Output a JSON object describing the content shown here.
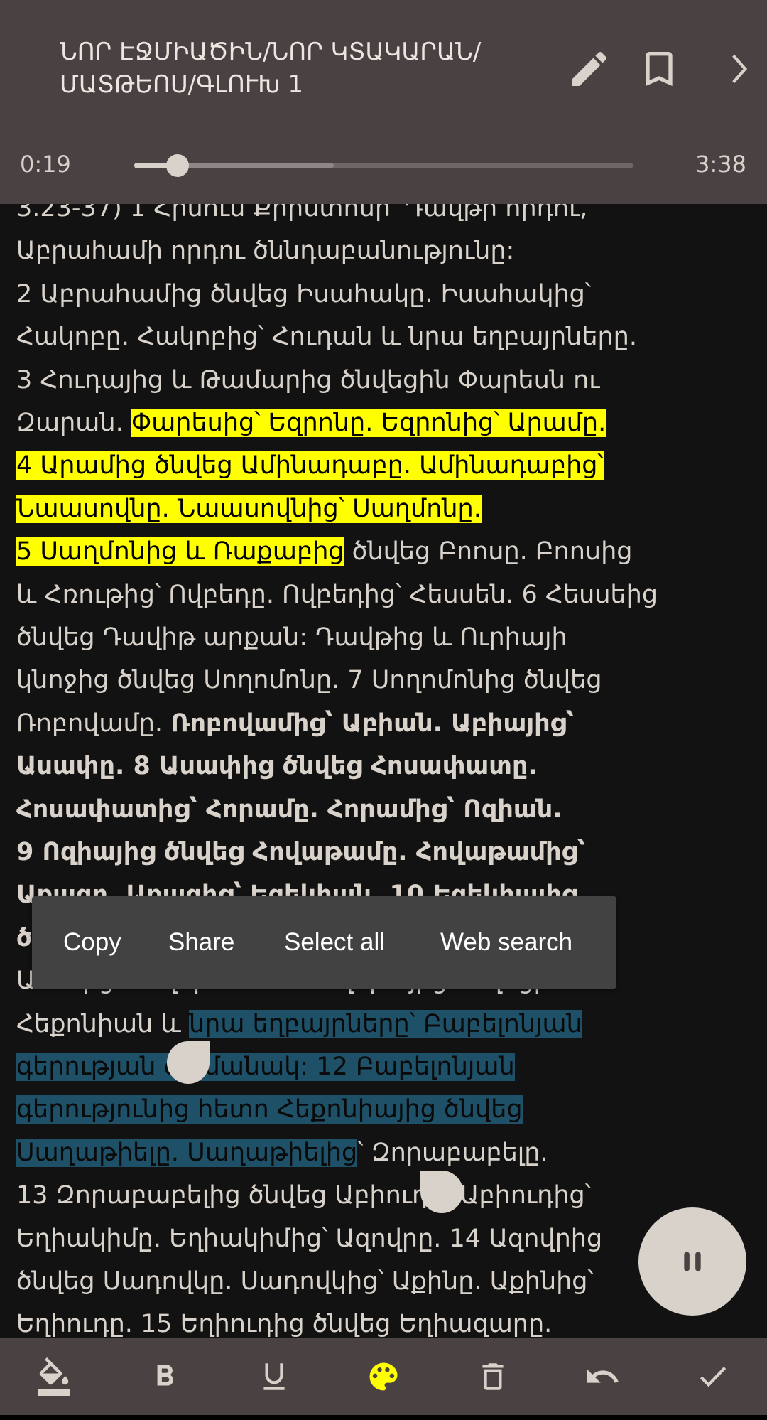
{
  "header": {
    "title_line1": "ՆՈՐ ԷՋՄԻԱԾԻՆ/ՆՈՐ ԿՏԱԿԱՐԱՆ/",
    "title_line2": "ՄԱՏԹԵՈՍ/ԳԼՈՒԽ 1",
    "icons": [
      "pencil-icon",
      "bookmark-icon",
      "chevron-right-icon"
    ]
  },
  "player": {
    "elapsed": "0:19",
    "duration": "3:38",
    "progress_percent": 8.7,
    "buffered_percent": 40
  },
  "text_lines": [
    [
      {
        "t": "3.23-37) 1 Հիսուս Քրիստոսի՝ Դավթի որդու,",
        "s": ""
      }
    ],
    [
      {
        "t": "Աբրահամի որդու ծննդաբանությունը:",
        "s": ""
      }
    ],
    [
      {
        "t": "2 Աբրահամից ծնվեց Իսահակը. Իսահակից՝",
        "s": ""
      }
    ],
    [
      {
        "t": "Հակոբը. Հակոբից՝ Հուդան և նրա եղբայրները.",
        "s": ""
      }
    ],
    [
      {
        "t": "3 Հուդայից և Թամարից ծնվեցին Փարեսն ու",
        "s": ""
      }
    ],
    [
      {
        "t": "Զարան. ",
        "s": ""
      },
      {
        "t": "Փարեսից՝ Եզրոնը. Եզրոնից՝ Արամը.",
        "s": "hl"
      }
    ],
    [
      {
        "t": "4 Արամից ծնվեց Ամինադաբը. Ամինադաբից՝",
        "s": "hl"
      }
    ],
    [
      {
        "t": "Նաասովնը. Նաասովնից՝ Սաղմոնը.",
        "s": "hl"
      }
    ],
    [
      {
        "t": "5 Սաղմոնից և Ռաքաբից",
        "s": "hl"
      },
      {
        "t": " ծնվեց Բոոսը. Բոոսից",
        "s": ""
      }
    ],
    [
      {
        "t": "և Հռութից՝ Ովբեդը. Ովբեդից՝ Հեսսեն. 6 Հեսսեից",
        "s": ""
      }
    ],
    [
      {
        "t": "ծնվեց Դավիթ արքան: Դավթից և Ուրիայի",
        "s": ""
      }
    ],
    [
      {
        "t": "կնոջից ծնվեց Սողոմոնը. 7 Սողոմոնից ծնվեց",
        "s": ""
      }
    ],
    [
      {
        "t": "Ռոբովամը. ",
        "s": ""
      },
      {
        "t": "Ռոբովամից՝ Աբիան. Աբիայից՝",
        "s": "bold"
      }
    ],
    [
      {
        "t": "Ասափը. 8 Ասափից ծնվեց Հոսափատը.",
        "s": "bold"
      }
    ],
    [
      {
        "t": "Հոսափատից՝ Հորամը. Հորամից՝ Ոզիան.",
        "s": "bold"
      }
    ],
    [
      {
        "t": "9 Ոզիայից ծնվեց Հովաթամը. Հովաթամից՝",
        "s": "bold"
      }
    ],
    [
      {
        "t": "Աքազը. Աքազից՝ Եզեկիան. 10 Եզեկիայից",
        "s": "bold"
      }
    ],
    [
      {
        "t": "ծ",
        "s": "bold"
      },
      {
        "t": "                                              ը.",
        "s": ""
      }
    ],
    [
      {
        "t": "Ամոնից՝ Հովսիան. 11 Հովսիայից ծնվեցին",
        "s": ""
      }
    ],
    [
      {
        "t": "Հեքոնիան և ",
        "s": ""
      },
      {
        "t": "նրա եղբայրները՝ Բաբելոնյան",
        "s": "sel"
      }
    ],
    [
      {
        "t": "գերության ժամանակ: 12 Բաբելոնյան",
        "s": "sel"
      }
    ],
    [
      {
        "t": "գերությունից հետո Հեքոնիայից ծնվեց",
        "s": "sel"
      }
    ],
    [
      {
        "t": "Սաղաթիելը. Սաղաթիելից",
        "s": "sel"
      },
      {
        "t": "՝ Զորաբաբելը.",
        "s": ""
      }
    ],
    [
      {
        "t": "13 Զորաբաբելից ծնվեց Աբիուդը. Աբիուդից՝",
        "s": ""
      }
    ],
    [
      {
        "t": "Եղիակիմը. Եղիակիմից՝ Ազովրը. 14 Ազովրից",
        "s": ""
      }
    ],
    [
      {
        "t": "ծնվեց Սադովկը. Սադովկից՝ Աքինը. Աքինից՝",
        "s": ""
      }
    ],
    [
      {
        "t": "Եղիուդը. 15 Եղիուդից ծնվեց Եղիազարը.",
        "s": ""
      }
    ]
  ],
  "context_menu": {
    "copy": "Copy",
    "share": "Share",
    "select_all": "Select all",
    "web_search": "Web search"
  },
  "fab": {
    "icon": "pause-icon"
  },
  "toolbar": {
    "icons": [
      "highlight-fill-icon",
      "bold-icon",
      "underline-icon",
      "palette-icon",
      "delete-icon",
      "undo-icon",
      "check-icon"
    ]
  },
  "colors": {
    "header_bg": "#4a4242",
    "text_bg": "#121212",
    "text": "#d8d2cb",
    "highlight": "#ffff00",
    "selection": "#1e5068",
    "palette_active": "#ffff00"
  }
}
